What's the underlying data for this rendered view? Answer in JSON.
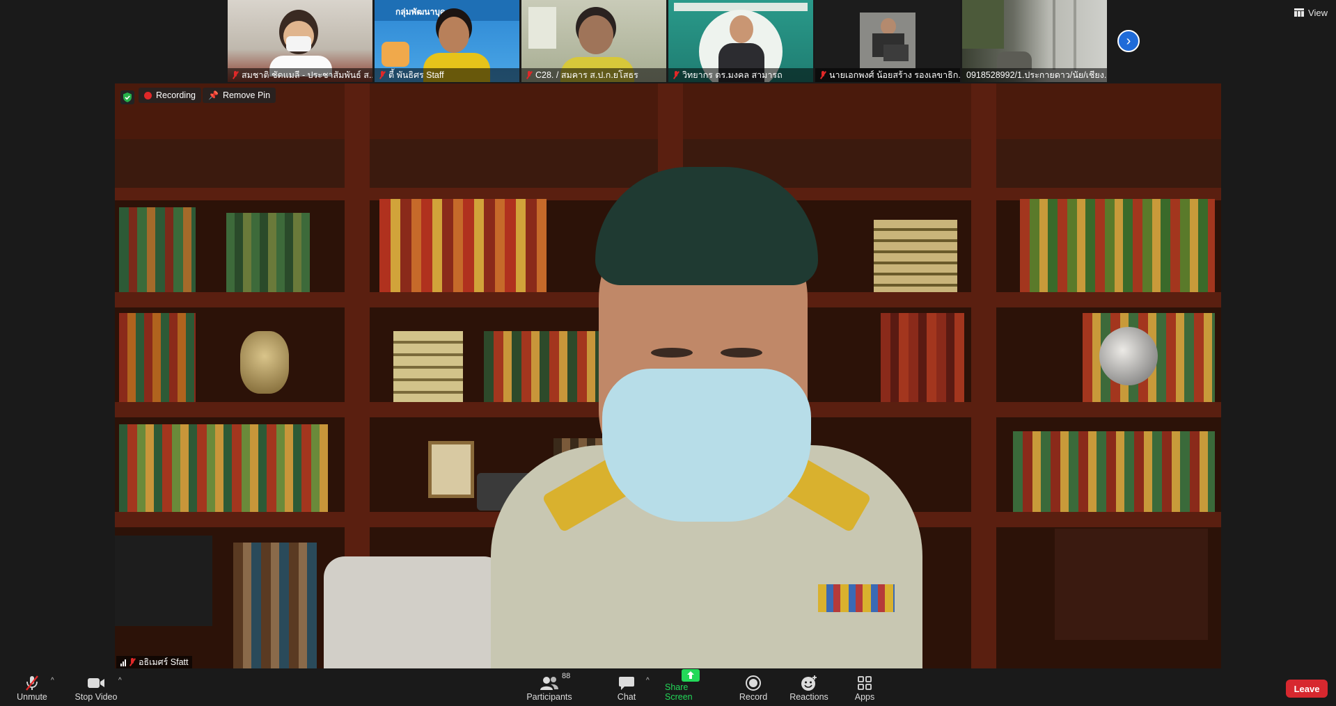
{
  "top_bar": {
    "view_label": "View"
  },
  "thumbnails": [
    {
      "name": "สมชาติ ชัดแมลี - ประชาสัมพันธ์ ส..."
    },
    {
      "name": "ตี้ พันธิศร Staff"
    },
    {
      "name": "C28. / สมคาร ส.ป.ก.ยโสธร"
    },
    {
      "name": "วิทยากร ดร.มงคล สามารถ"
    },
    {
      "name": "นายเอกพงศ์ น้อยสร้าง รองเลขาธิก..."
    },
    {
      "name": "0918528992/1.ประกายดาว/นัย/เชียง..."
    }
  ],
  "thumbnail_header_text": "กลุ่มพัฒนาบุค",
  "main_video": {
    "recording_label": "Recording",
    "remove_pin_label": "Remove Pin",
    "speaker_name": "อธิเมศร์ Sfatt"
  },
  "toolbar": {
    "unmute_label": "Unmute",
    "stop_video_label": "Stop Video",
    "participants_label": "Participants",
    "participants_count": "88",
    "chat_label": "Chat",
    "share_screen_label": "Share Screen",
    "record_label": "Record",
    "reactions_label": "Reactions",
    "apps_label": "Apps",
    "leave_label": "Leave"
  },
  "colors": {
    "muted_red": "#e02828",
    "share_green": "#23d959",
    "leave_red": "#d7282f",
    "next_blue": "#1f6bd8"
  },
  "icons": [
    "view-icon",
    "mic-muted-icon",
    "video-camera-icon",
    "participants-icon",
    "chat-icon",
    "share-screen-icon",
    "record-icon",
    "reactions-icon",
    "apps-icon",
    "shield-icon",
    "chevron-right-icon",
    "pin-icon",
    "signal-icon"
  ]
}
